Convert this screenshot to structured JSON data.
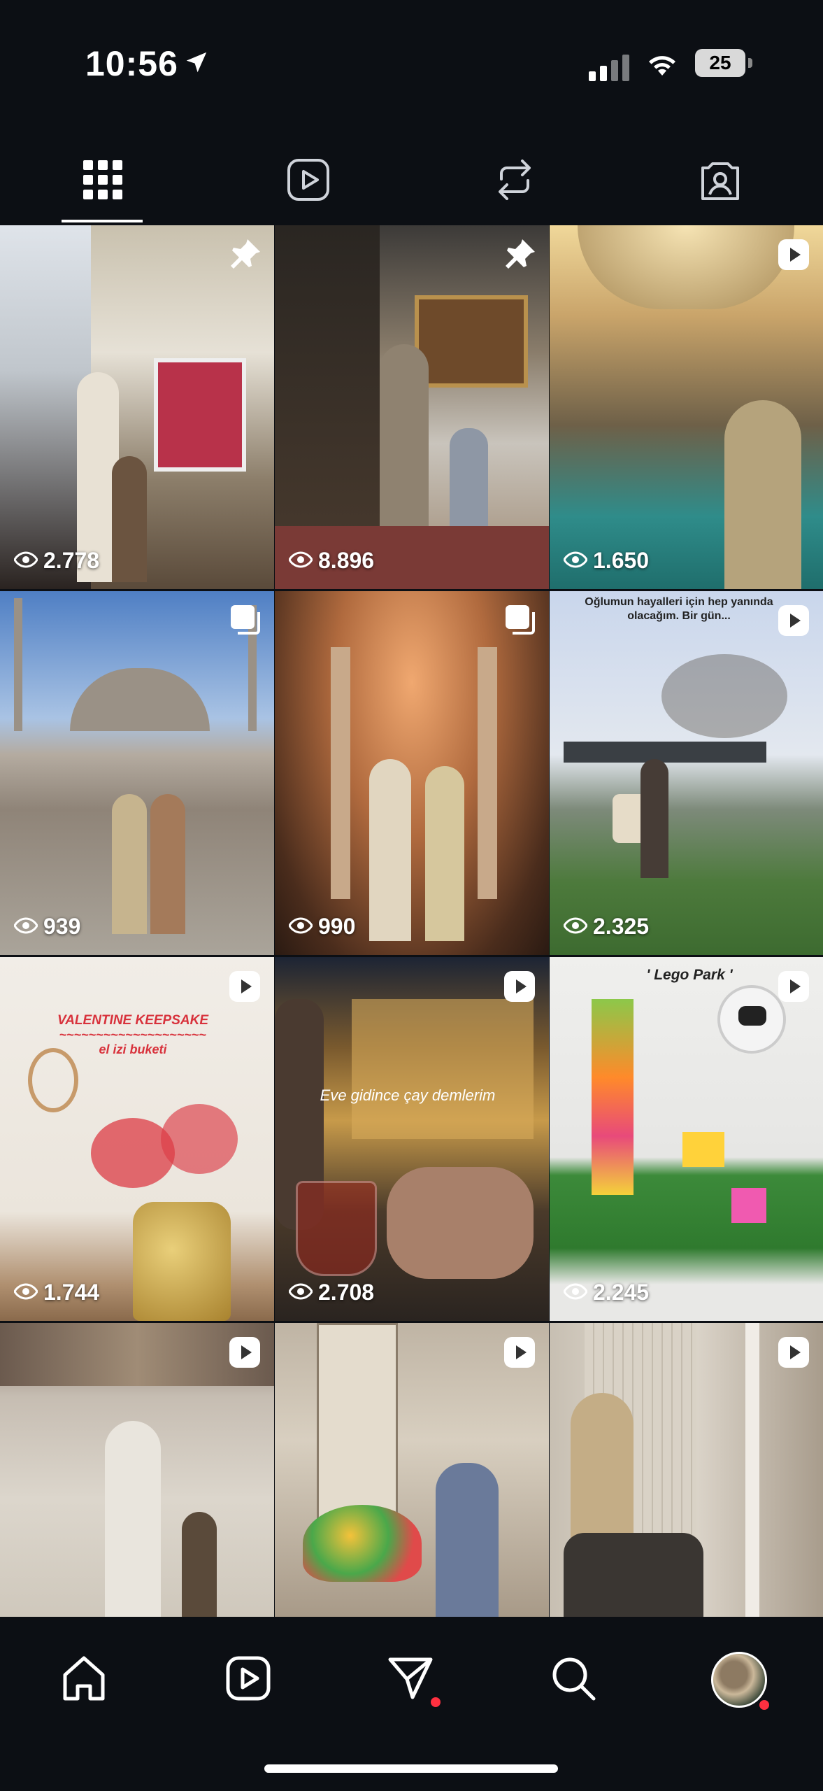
{
  "status_bar": {
    "time": "10:56",
    "battery": "25"
  },
  "tabs": [
    {
      "name": "grid",
      "icon": "grid-icon",
      "active": true
    },
    {
      "name": "reels",
      "icon": "reels-icon",
      "active": false
    },
    {
      "name": "reposts",
      "icon": "repost-icon",
      "active": false
    },
    {
      "name": "tagged",
      "icon": "tagged-icon",
      "active": false
    }
  ],
  "posts": [
    {
      "views": "2.778",
      "badge": "pin-icon"
    },
    {
      "views": "8.896",
      "badge": "pin-icon"
    },
    {
      "views": "1.650",
      "badge": "reel-icon"
    },
    {
      "views": "939",
      "badge": "carousel-icon"
    },
    {
      "views": "990",
      "badge": "carousel-icon"
    },
    {
      "views": "2.325",
      "badge": "reel-icon",
      "caption": "Oğlumun hayalleri için hep yanında olacağım. Bir gün..."
    },
    {
      "views": "1.744",
      "badge": "reel-icon",
      "caption": "VALENTINE KEEPSAKE",
      "caption_2": "~~~~~~~~~~~~~~~~~~~~",
      "caption_3": "el izi buketi"
    },
    {
      "views": "2.708",
      "badge": "reel-icon",
      "caption": "Eve gidince çay demlerim"
    },
    {
      "views": "2.245",
      "badge": "reel-icon",
      "caption": "' Lego Park '"
    },
    {
      "views": "",
      "badge": "reel-icon"
    },
    {
      "views": "",
      "badge": "reel-icon"
    },
    {
      "views": "",
      "badge": "reel-icon"
    }
  ],
  "bottom_nav": [
    "home-icon",
    "reels-icon",
    "messages-icon",
    "search-icon",
    "profile-avatar"
  ],
  "colors": {
    "background": "#0c0f14",
    "notification": "#ff3040"
  }
}
